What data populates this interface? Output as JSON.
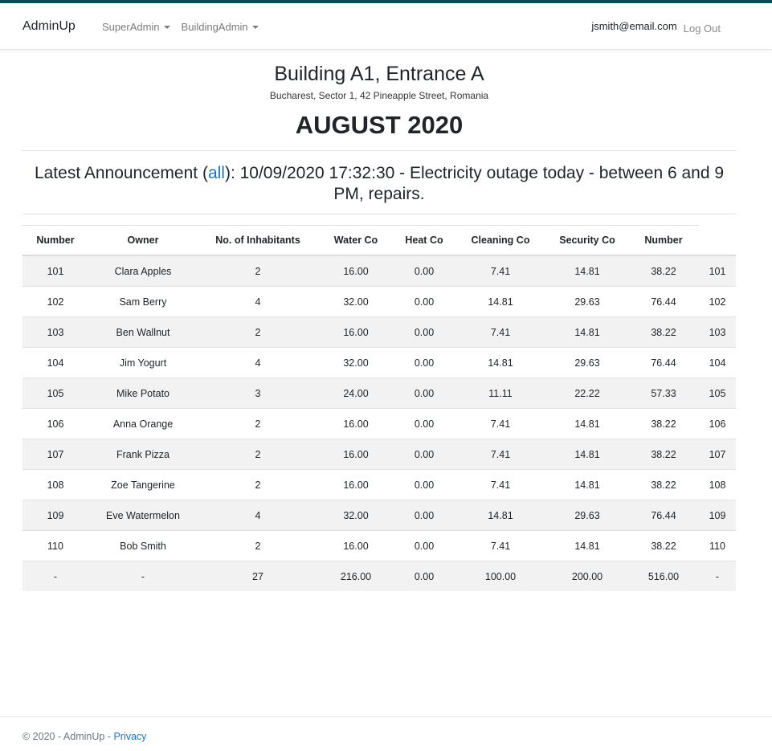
{
  "nav": {
    "brand": "AdminUp",
    "menus": [
      "SuperAdmin",
      "BuildingAdmin"
    ],
    "user_email": "jsmith@email.com",
    "logout": "Log Out"
  },
  "building": {
    "title": "Building A1, Entrance A",
    "address": "Bucharest, Sector 1, 42 Pineapple Street, Romania",
    "month": "AUGUST 2020"
  },
  "announcement": {
    "prefix": "Latest Announcement (",
    "link": "all",
    "suffix": "): 10/09/2020 17:32:30 - Electricity outage today - between 6 and 9 PM, repairs."
  },
  "table": {
    "columns": [
      "Number",
      "Owner",
      "No. of Inhabitants",
      "Water Co",
      "Heat Co",
      "Cleaning Co",
      "Security Co",
      "Number",
      ""
    ],
    "rows": [
      [
        "101",
        "Clara Apples",
        "2",
        "16.00",
        "0.00",
        "7.41",
        "14.81",
        "38.22",
        "101"
      ],
      [
        "102",
        "Sam Berry",
        "4",
        "32.00",
        "0.00",
        "14.81",
        "29.63",
        "76.44",
        "102"
      ],
      [
        "103",
        "Ben Wallnut",
        "2",
        "16.00",
        "0.00",
        "7.41",
        "14.81",
        "38.22",
        "103"
      ],
      [
        "104",
        "Jim Yogurt",
        "4",
        "32.00",
        "0.00",
        "14.81",
        "29.63",
        "76.44",
        "104"
      ],
      [
        "105",
        "Mike Potato",
        "3",
        "24.00",
        "0.00",
        "11.11",
        "22.22",
        "57.33",
        "105"
      ],
      [
        "106",
        "Anna Orange",
        "2",
        "16.00",
        "0.00",
        "7.41",
        "14.81",
        "38.22",
        "106"
      ],
      [
        "107",
        "Frank Pizza",
        "2",
        "16.00",
        "0.00",
        "7.41",
        "14.81",
        "38.22",
        "107"
      ],
      [
        "108",
        "Zoe Tangerine",
        "2",
        "16.00",
        "0.00",
        "7.41",
        "14.81",
        "38.22",
        "108"
      ],
      [
        "109",
        "Eve Watermelon",
        "4",
        "32.00",
        "0.00",
        "14.81",
        "29.63",
        "76.44",
        "109"
      ],
      [
        "110",
        "Bob Smith",
        "2",
        "16.00",
        "0.00",
        "7.41",
        "14.81",
        "38.22",
        "110"
      ],
      [
        "-",
        "-",
        "27",
        "216.00",
        "0.00",
        "100.00",
        "200.00",
        "516.00",
        "-"
      ]
    ]
  },
  "footer": {
    "text": "© 2020 - AdminUp - ",
    "privacy": "Privacy"
  }
}
